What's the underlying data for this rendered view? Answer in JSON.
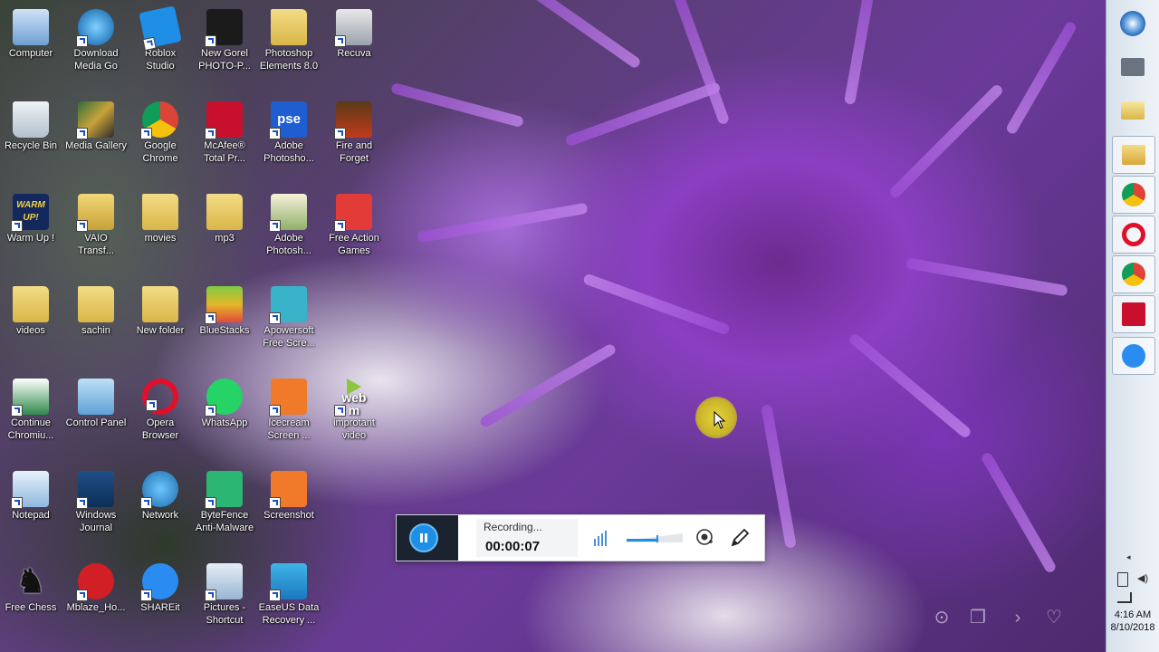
{
  "desktop": {
    "icons": [
      {
        "label": "Computer"
      },
      {
        "label": "Download\nMedia Go"
      },
      {
        "label": "Roblox\nStudio"
      },
      {
        "label": "New Gorel\nPHOTO-P..."
      },
      {
        "label": "Photoshop\nElements 8.0"
      },
      {
        "label": "Recuva"
      },
      {
        "label": "Recycle Bin"
      },
      {
        "label": "Media Gallery"
      },
      {
        "label": "Google\nChrome"
      },
      {
        "label": "McAfee®\nTotal Pr..."
      },
      {
        "label": "Adobe\nPhotosho..."
      },
      {
        "label": "Fire and\nForget"
      },
      {
        "label": "Warm Up !"
      },
      {
        "label": "VAIO\nTransf..."
      },
      {
        "label": "movies"
      },
      {
        "label": "mp3"
      },
      {
        "label": "Adobe\nPhotosh..."
      },
      {
        "label": "Free Action\nGames"
      },
      {
        "label": "videos"
      },
      {
        "label": "sachin"
      },
      {
        "label": "New folder"
      },
      {
        "label": "BlueStacks"
      },
      {
        "label": "Apowersoft\nFree Scre..."
      },
      {
        "label": "Continue\nChromiu..."
      },
      {
        "label": "Control Panel"
      },
      {
        "label": "Opera\nBrowser"
      },
      {
        "label": "WhatsApp"
      },
      {
        "label": "Icecream\nScreen ..."
      },
      {
        "label": "improtant\nvideo"
      },
      {
        "label": "Notepad"
      },
      {
        "label": "Windows\nJournal"
      },
      {
        "label": "Network"
      },
      {
        "label": "ByteFence\nAnti-Malware"
      },
      {
        "label": "Screenshot"
      },
      {
        "label": "Free Chess"
      },
      {
        "label": "Mblaze_Ho..."
      },
      {
        "label": "SHAREit"
      },
      {
        "label": "Pictures -\nShortcut"
      },
      {
        "label": "EaseUS Data\nRecovery ..."
      }
    ],
    "webm_text": "web m",
    "warm_text": "WARM UP!",
    "pse_text": "pse"
  },
  "recorder": {
    "status": "Recording...",
    "time": "00:00:07",
    "volume_level": 0.55
  },
  "taskbar": {
    "time": "4:16 AM",
    "date": "8/10/2018"
  },
  "colors": {
    "accent": "#1f8fe5",
    "recorder_dark": "#1c2330",
    "cursor_highlight": "#e9d23c"
  }
}
